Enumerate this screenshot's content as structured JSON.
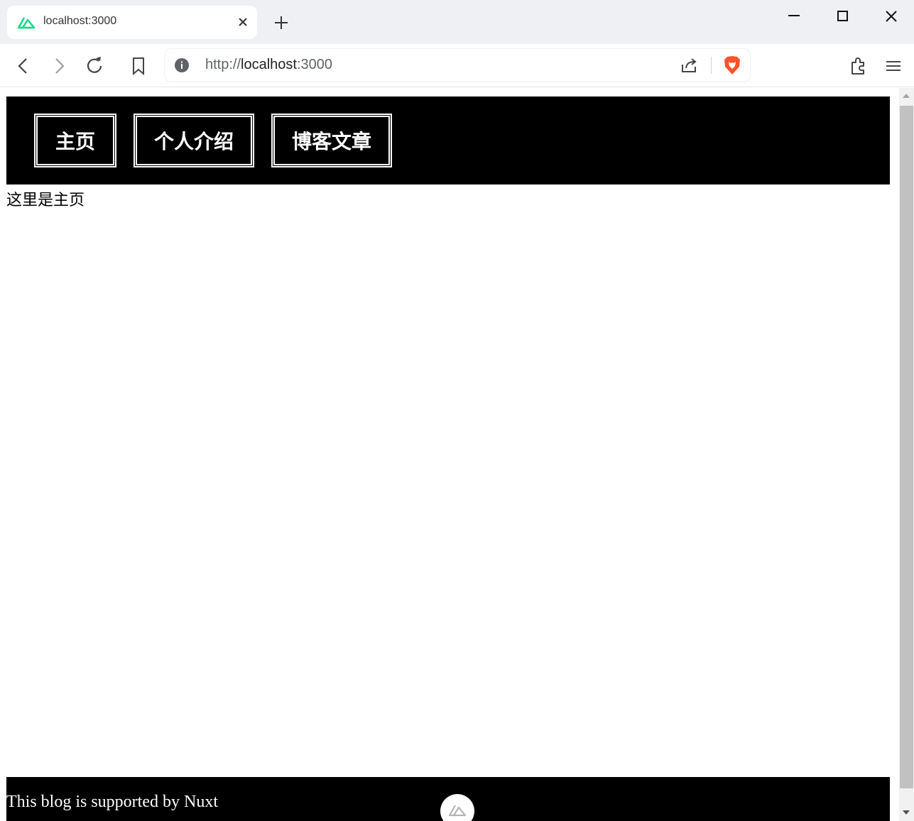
{
  "browser": {
    "tab": {
      "title": "localhost:3000",
      "logo_icon": "nuxt-logo-icon",
      "accent": "#00dc82"
    },
    "url": {
      "scheme": "http://",
      "host": "localhost",
      "port": ":3000"
    },
    "brave_color": "#fb542b"
  },
  "site": {
    "nav": [
      {
        "label": "主页"
      },
      {
        "label": "个人介绍"
      },
      {
        "label": "博客文章"
      }
    ],
    "content": "这里是主页",
    "footer": "This blog is supported by Nuxt"
  }
}
